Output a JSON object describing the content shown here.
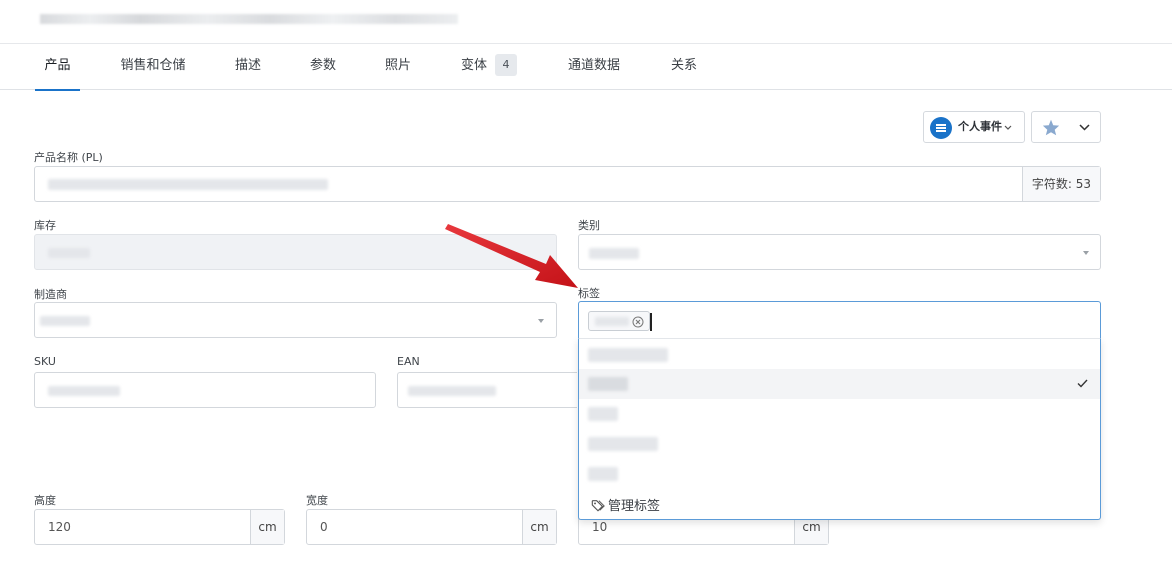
{
  "tabs": [
    {
      "label": "产品",
      "active": true
    },
    {
      "label": "销售和仓储"
    },
    {
      "label": "描述"
    },
    {
      "label": "参数"
    },
    {
      "label": "照片"
    },
    {
      "label": "变体",
      "badge": "4"
    },
    {
      "label": "通道数据"
    },
    {
      "label": "关系"
    }
  ],
  "toolbar": {
    "events_label": "个人事件",
    "events_icon": "list-icon",
    "fav_icon": "star-icon",
    "fav_chevron_icon": "chevron-down-icon"
  },
  "product_name": {
    "label": "产品名称 (PL)",
    "char_count_label": "字符数: 53"
  },
  "stock": {
    "label": "库存"
  },
  "category": {
    "label": "类别"
  },
  "manufacturer": {
    "label": "制造商"
  },
  "tags": {
    "label": "标签",
    "manage_label": "管理标签",
    "manage_icon": "tag-icon",
    "selected_check_icon": "check-icon"
  },
  "sku": {
    "label": "SKU"
  },
  "ean": {
    "label": "EAN"
  },
  "dimensions": {
    "height": {
      "label": "高度",
      "value": "120",
      "unit": "cm"
    },
    "width": {
      "label": "宽度",
      "value": "0",
      "unit": "cm"
    },
    "length": {
      "value": "10",
      "unit": "cm"
    }
  },
  "colors": {
    "accent": "#1a73c9",
    "focus_border": "#5b9bd8",
    "arrow": "#d0191f"
  }
}
